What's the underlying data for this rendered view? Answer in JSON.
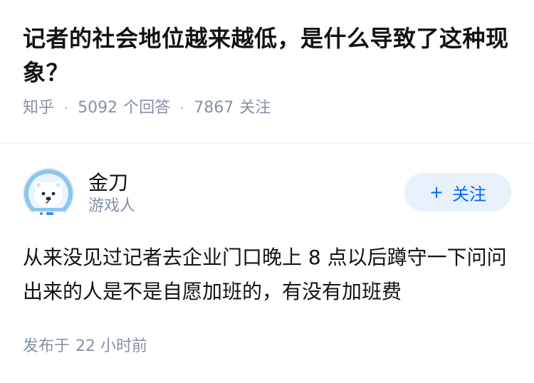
{
  "question": {
    "title": "记者的社会地位越来越低，是什么导致了这种现象？",
    "source": "知乎",
    "answer_count": "5092",
    "answer_label": "个回答",
    "follower_count": "7867",
    "follower_label": "关注"
  },
  "answer": {
    "author": {
      "name": "金刀",
      "headline": "游戏人",
      "avatar_icon": "polar-bear-astronaut-avatar"
    },
    "follow_button": {
      "plus": "+",
      "label": "关注"
    },
    "content": "从来没见过记者去企业门口晚上 8 点以后蹲守一下问问出来的人是不是自愿加班的，有没有加班费",
    "time_prefix": "发布于",
    "time_value": "22 小时前"
  },
  "colors": {
    "text": "#121212",
    "meta": "#8590a6",
    "accent": "#0066ff",
    "follow_bg": "#e8f0fb"
  }
}
